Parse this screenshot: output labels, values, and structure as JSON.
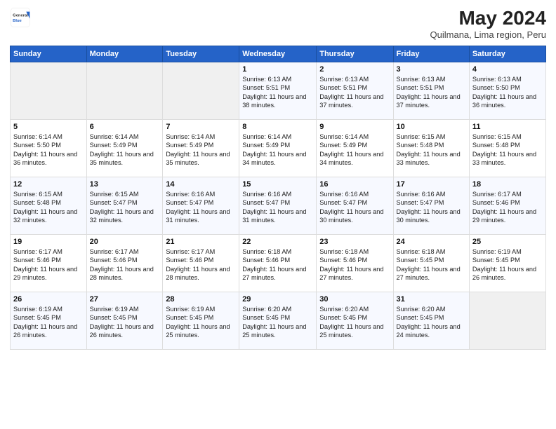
{
  "header": {
    "logo_general": "General",
    "logo_blue": "Blue",
    "month_title": "May 2024",
    "location": "Quilmana, Lima region, Peru"
  },
  "days_of_week": [
    "Sunday",
    "Monday",
    "Tuesday",
    "Wednesday",
    "Thursday",
    "Friday",
    "Saturday"
  ],
  "weeks": [
    [
      {
        "day": "",
        "info": ""
      },
      {
        "day": "",
        "info": ""
      },
      {
        "day": "",
        "info": ""
      },
      {
        "day": "1",
        "info": "Sunrise: 6:13 AM\nSunset: 5:51 PM\nDaylight: 11 hours and 38 minutes."
      },
      {
        "day": "2",
        "info": "Sunrise: 6:13 AM\nSunset: 5:51 PM\nDaylight: 11 hours and 37 minutes."
      },
      {
        "day": "3",
        "info": "Sunrise: 6:13 AM\nSunset: 5:51 PM\nDaylight: 11 hours and 37 minutes."
      },
      {
        "day": "4",
        "info": "Sunrise: 6:13 AM\nSunset: 5:50 PM\nDaylight: 11 hours and 36 minutes."
      }
    ],
    [
      {
        "day": "5",
        "info": "Sunrise: 6:14 AM\nSunset: 5:50 PM\nDaylight: 11 hours and 36 minutes."
      },
      {
        "day": "6",
        "info": "Sunrise: 6:14 AM\nSunset: 5:49 PM\nDaylight: 11 hours and 35 minutes."
      },
      {
        "day": "7",
        "info": "Sunrise: 6:14 AM\nSunset: 5:49 PM\nDaylight: 11 hours and 35 minutes."
      },
      {
        "day": "8",
        "info": "Sunrise: 6:14 AM\nSunset: 5:49 PM\nDaylight: 11 hours and 34 minutes."
      },
      {
        "day": "9",
        "info": "Sunrise: 6:14 AM\nSunset: 5:49 PM\nDaylight: 11 hours and 34 minutes."
      },
      {
        "day": "10",
        "info": "Sunrise: 6:15 AM\nSunset: 5:48 PM\nDaylight: 11 hours and 33 minutes."
      },
      {
        "day": "11",
        "info": "Sunrise: 6:15 AM\nSunset: 5:48 PM\nDaylight: 11 hours and 33 minutes."
      }
    ],
    [
      {
        "day": "12",
        "info": "Sunrise: 6:15 AM\nSunset: 5:48 PM\nDaylight: 11 hours and 32 minutes."
      },
      {
        "day": "13",
        "info": "Sunrise: 6:15 AM\nSunset: 5:47 PM\nDaylight: 11 hours and 32 minutes."
      },
      {
        "day": "14",
        "info": "Sunrise: 6:16 AM\nSunset: 5:47 PM\nDaylight: 11 hours and 31 minutes."
      },
      {
        "day": "15",
        "info": "Sunrise: 6:16 AM\nSunset: 5:47 PM\nDaylight: 11 hours and 31 minutes."
      },
      {
        "day": "16",
        "info": "Sunrise: 6:16 AM\nSunset: 5:47 PM\nDaylight: 11 hours and 30 minutes."
      },
      {
        "day": "17",
        "info": "Sunrise: 6:16 AM\nSunset: 5:47 PM\nDaylight: 11 hours and 30 minutes."
      },
      {
        "day": "18",
        "info": "Sunrise: 6:17 AM\nSunset: 5:46 PM\nDaylight: 11 hours and 29 minutes."
      }
    ],
    [
      {
        "day": "19",
        "info": "Sunrise: 6:17 AM\nSunset: 5:46 PM\nDaylight: 11 hours and 29 minutes."
      },
      {
        "day": "20",
        "info": "Sunrise: 6:17 AM\nSunset: 5:46 PM\nDaylight: 11 hours and 28 minutes."
      },
      {
        "day": "21",
        "info": "Sunrise: 6:17 AM\nSunset: 5:46 PM\nDaylight: 11 hours and 28 minutes."
      },
      {
        "day": "22",
        "info": "Sunrise: 6:18 AM\nSunset: 5:46 PM\nDaylight: 11 hours and 27 minutes."
      },
      {
        "day": "23",
        "info": "Sunrise: 6:18 AM\nSunset: 5:46 PM\nDaylight: 11 hours and 27 minutes."
      },
      {
        "day": "24",
        "info": "Sunrise: 6:18 AM\nSunset: 5:45 PM\nDaylight: 11 hours and 27 minutes."
      },
      {
        "day": "25",
        "info": "Sunrise: 6:19 AM\nSunset: 5:45 PM\nDaylight: 11 hours and 26 minutes."
      }
    ],
    [
      {
        "day": "26",
        "info": "Sunrise: 6:19 AM\nSunset: 5:45 PM\nDaylight: 11 hours and 26 minutes."
      },
      {
        "day": "27",
        "info": "Sunrise: 6:19 AM\nSunset: 5:45 PM\nDaylight: 11 hours and 26 minutes."
      },
      {
        "day": "28",
        "info": "Sunrise: 6:19 AM\nSunset: 5:45 PM\nDaylight: 11 hours and 25 minutes."
      },
      {
        "day": "29",
        "info": "Sunrise: 6:20 AM\nSunset: 5:45 PM\nDaylight: 11 hours and 25 minutes."
      },
      {
        "day": "30",
        "info": "Sunrise: 6:20 AM\nSunset: 5:45 PM\nDaylight: 11 hours and 25 minutes."
      },
      {
        "day": "31",
        "info": "Sunrise: 6:20 AM\nSunset: 5:45 PM\nDaylight: 11 hours and 24 minutes."
      },
      {
        "day": "",
        "info": ""
      }
    ]
  ]
}
